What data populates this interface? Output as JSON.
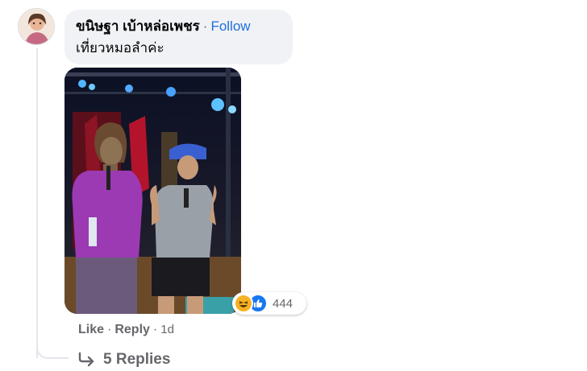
{
  "comment": {
    "author": "ขนิษฐา เบ้าหล่อเพชร",
    "separator": "·",
    "follow_label": "Follow",
    "text": "เที่ยวหมอลำค่ะ"
  },
  "reactions": {
    "types": [
      "haha",
      "like"
    ],
    "count": "444"
  },
  "actions": {
    "like_label": "Like",
    "dot": "·",
    "reply_label": "Reply",
    "timestamp": "1d"
  },
  "replies": {
    "label": "5 Replies"
  },
  "icons": {
    "reply_arrow": "reply-arrow-icon",
    "haha": "haha-reaction-icon",
    "like": "like-reaction-icon"
  },
  "colors": {
    "link_blue": "#216fdb",
    "bubble_bg": "#f0f2f5",
    "secondary_text": "#65676b",
    "like_blue": "#1877f2",
    "haha_yellow": "#f7b125"
  }
}
